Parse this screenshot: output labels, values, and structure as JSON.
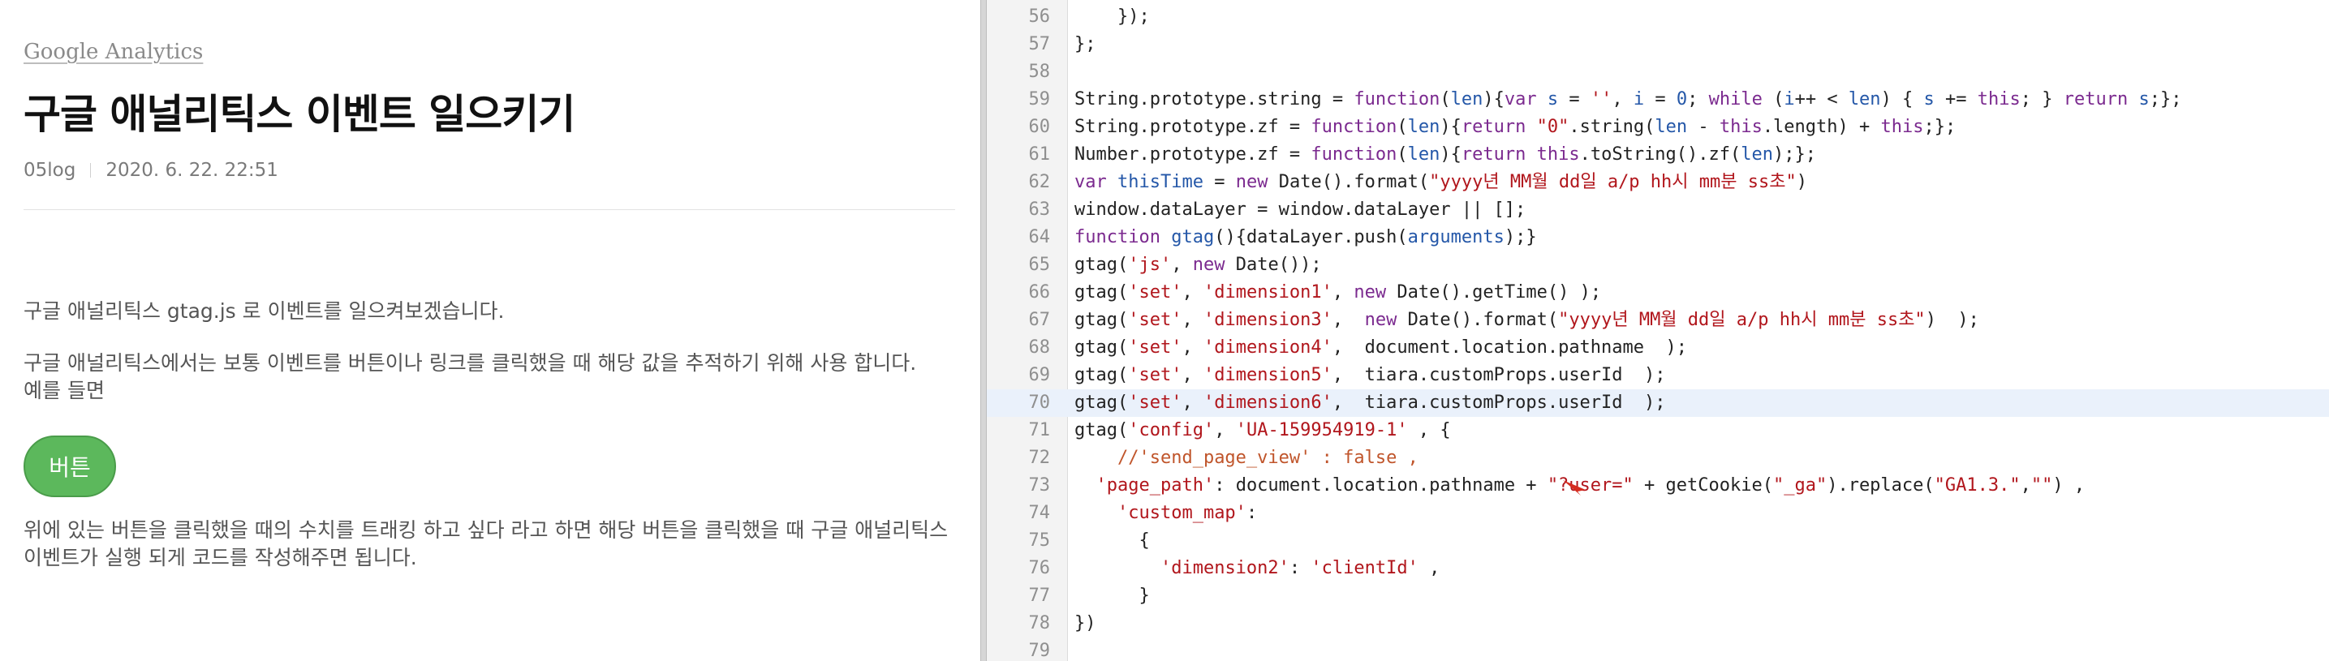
{
  "blog": {
    "category": "Google Analytics",
    "title": "구글 애널리틱스 이벤트 일으키기",
    "author": "05log",
    "date": "2020. 6. 22. 22:51",
    "paragraphs": [
      "구글 애널리틱스 gtag.js 로 이벤트를 일으켜보겠습니다.",
      "구글 애널리틱스에서는 보통 이벤트를 버튼이나 링크를 클릭했을 때 해당 값을 추적하기 위해 사용 합니다.",
      "예를 들면"
    ],
    "demo_button_label": "버튼",
    "after_button": "위에 있는 버튼을 클릭했을 때의 수치를 트래킹 하고 싶다 라고 하면 해당 버튼을 클릭했을 때 구글 애널리틱스 이벤트가 실행 되게 코드를 작성해주면 됩니다."
  },
  "code": {
    "highlight_line": "70",
    "lines": [
      {
        "n": "56",
        "tokens": [
          {
            "t": "    });"
          }
        ]
      },
      {
        "n": "57",
        "tokens": [
          {
            "t": "};"
          }
        ]
      },
      {
        "n": "58",
        "tokens": [
          {
            "t": ""
          }
        ]
      },
      {
        "n": "59",
        "tokens": [
          {
            "t": "String.prototype.string = "
          },
          {
            "t": "function",
            "c": "kw"
          },
          {
            "t": "("
          },
          {
            "t": "len",
            "c": "var"
          },
          {
            "t": "){"
          },
          {
            "t": "var",
            "c": "kw"
          },
          {
            "t": " "
          },
          {
            "t": "s",
            "c": "var"
          },
          {
            "t": " = "
          },
          {
            "t": "''",
            "c": "str"
          },
          {
            "t": ", "
          },
          {
            "t": "i",
            "c": "var"
          },
          {
            "t": " = "
          },
          {
            "t": "0",
            "c": "var"
          },
          {
            "t": "; "
          },
          {
            "t": "while",
            "c": "kw"
          },
          {
            "t": " ("
          },
          {
            "t": "i",
            "c": "var"
          },
          {
            "t": "++ < "
          },
          {
            "t": "len",
            "c": "var"
          },
          {
            "t": ") { "
          },
          {
            "t": "s",
            "c": "var"
          },
          {
            "t": " += "
          },
          {
            "t": "this",
            "c": "kw"
          },
          {
            "t": "; } "
          },
          {
            "t": "return",
            "c": "kw"
          },
          {
            "t": " "
          },
          {
            "t": "s",
            "c": "var"
          },
          {
            "t": ";};"
          }
        ]
      },
      {
        "n": "60",
        "tokens": [
          {
            "t": "String.prototype.zf = "
          },
          {
            "t": "function",
            "c": "kw"
          },
          {
            "t": "("
          },
          {
            "t": "len",
            "c": "var"
          },
          {
            "t": "){"
          },
          {
            "t": "return",
            "c": "kw"
          },
          {
            "t": " "
          },
          {
            "t": "\"0\"",
            "c": "str"
          },
          {
            "t": ".string("
          },
          {
            "t": "len",
            "c": "var"
          },
          {
            "t": " - "
          },
          {
            "t": "this",
            "c": "kw"
          },
          {
            "t": ".length) + "
          },
          {
            "t": "this",
            "c": "kw"
          },
          {
            "t": ";};"
          }
        ]
      },
      {
        "n": "61",
        "tokens": [
          {
            "t": "Number.prototype.zf = "
          },
          {
            "t": "function",
            "c": "kw"
          },
          {
            "t": "("
          },
          {
            "t": "len",
            "c": "var"
          },
          {
            "t": "){"
          },
          {
            "t": "return",
            "c": "kw"
          },
          {
            "t": " "
          },
          {
            "t": "this",
            "c": "kw"
          },
          {
            "t": ".toString().zf("
          },
          {
            "t": "len",
            "c": "var"
          },
          {
            "t": ");};"
          }
        ]
      },
      {
        "n": "62",
        "tokens": [
          {
            "t": "var",
            "c": "kw"
          },
          {
            "t": " "
          },
          {
            "t": "thisTime",
            "c": "var"
          },
          {
            "t": " = "
          },
          {
            "t": "new",
            "c": "kw"
          },
          {
            "t": " Date().format("
          },
          {
            "t": "\"yyyy년 MM월 dd일 a/p hh시 mm분 ss초\"",
            "c": "str"
          },
          {
            "t": ")"
          }
        ]
      },
      {
        "n": "63",
        "tokens": [
          {
            "t": "window.dataLayer = window.dataLayer || [];"
          }
        ]
      },
      {
        "n": "64",
        "tokens": [
          {
            "t": "function",
            "c": "kw"
          },
          {
            "t": " "
          },
          {
            "t": "gtag",
            "c": "var"
          },
          {
            "t": "(){dataLayer.push("
          },
          {
            "t": "arguments",
            "c": "var"
          },
          {
            "t": ");}"
          }
        ]
      },
      {
        "n": "65",
        "tokens": [
          {
            "t": "gtag("
          },
          {
            "t": "'js'",
            "c": "str"
          },
          {
            "t": ", "
          },
          {
            "t": "new",
            "c": "kw"
          },
          {
            "t": " Date());"
          }
        ]
      },
      {
        "n": "66",
        "tokens": [
          {
            "t": "gtag("
          },
          {
            "t": "'set'",
            "c": "str"
          },
          {
            "t": ", "
          },
          {
            "t": "'dimension1'",
            "c": "str"
          },
          {
            "t": ", "
          },
          {
            "t": "new",
            "c": "kw"
          },
          {
            "t": " Date().getTime() );"
          }
        ]
      },
      {
        "n": "67",
        "tokens": [
          {
            "t": "gtag("
          },
          {
            "t": "'set'",
            "c": "str"
          },
          {
            "t": ", "
          },
          {
            "t": "'dimension3'",
            "c": "str"
          },
          {
            "t": ",  "
          },
          {
            "t": "new",
            "c": "kw"
          },
          {
            "t": " Date().format("
          },
          {
            "t": "\"yyyy년 MM월 dd일 a/p hh시 mm분 ss초\"",
            "c": "str"
          },
          {
            "t": ")  );"
          }
        ]
      },
      {
        "n": "68",
        "tokens": [
          {
            "t": "gtag("
          },
          {
            "t": "'set'",
            "c": "str"
          },
          {
            "t": ", "
          },
          {
            "t": "'dimension4'",
            "c": "str"
          },
          {
            "t": ",  document.location.pathname  );"
          }
        ]
      },
      {
        "n": "69",
        "tokens": [
          {
            "t": "gtag("
          },
          {
            "t": "'set'",
            "c": "str"
          },
          {
            "t": ", "
          },
          {
            "t": "'dimension5'",
            "c": "str"
          },
          {
            "t": ",  tiara.customProps.userId  );"
          }
        ]
      },
      {
        "n": "70",
        "tokens": [
          {
            "t": "gtag("
          },
          {
            "t": "'set'",
            "c": "str"
          },
          {
            "t": ", "
          },
          {
            "t": "'dimension6'",
            "c": "str"
          },
          {
            "t": ",  tiara.customProps.userId  );"
          }
        ]
      },
      {
        "n": "71",
        "tokens": [
          {
            "t": "gtag("
          },
          {
            "t": "'config'",
            "c": "str"
          },
          {
            "t": ", "
          },
          {
            "t": "'UA-159954919-1'",
            "c": "str"
          },
          {
            "t": " , {"
          }
        ]
      },
      {
        "n": "72",
        "tokens": [
          {
            "t": "    "
          },
          {
            "t": "//'send_page_view' : false ,",
            "c": "cmt"
          }
        ]
      },
      {
        "n": "73",
        "tokens": [
          {
            "t": "  "
          },
          {
            "t": "'page_path'",
            "c": "str"
          },
          {
            "t": ": document.location.pathname + "
          },
          {
            "t": "\"?user=\"",
            "c": "str"
          },
          {
            "t": " + getCookie("
          },
          {
            "t": "\"_ga\"",
            "c": "str"
          },
          {
            "t": ").replace("
          },
          {
            "t": "\"GA1.3.\"",
            "c": "str"
          },
          {
            "t": ","
          },
          {
            "t": "\"\"",
            "c": "str"
          },
          {
            "t": ") ,"
          }
        ]
      },
      {
        "n": "74",
        "tokens": [
          {
            "t": "    "
          },
          {
            "t": "'custom_map'",
            "c": "str"
          },
          {
            "t": ":"
          }
        ]
      },
      {
        "n": "75",
        "tokens": [
          {
            "t": "      {"
          }
        ]
      },
      {
        "n": "76",
        "tokens": [
          {
            "t": "        "
          },
          {
            "t": "'dimension2'",
            "c": "str"
          },
          {
            "t": ": "
          },
          {
            "t": "'clientId'",
            "c": "str"
          },
          {
            "t": " ,"
          }
        ]
      },
      {
        "n": "77",
        "tokens": [
          {
            "t": "      }"
          }
        ]
      },
      {
        "n": "78",
        "tokens": [
          {
            "t": "})"
          }
        ]
      },
      {
        "n": "79",
        "tokens": [
          {
            "t": ""
          }
        ]
      }
    ]
  },
  "colors": {
    "keyword": "#7b2a8f",
    "string": "#b1161c",
    "variable": "#2457a8",
    "comment": "#c0552b",
    "button": "#5cb85c",
    "line_highlight": "#eaf1fb"
  }
}
